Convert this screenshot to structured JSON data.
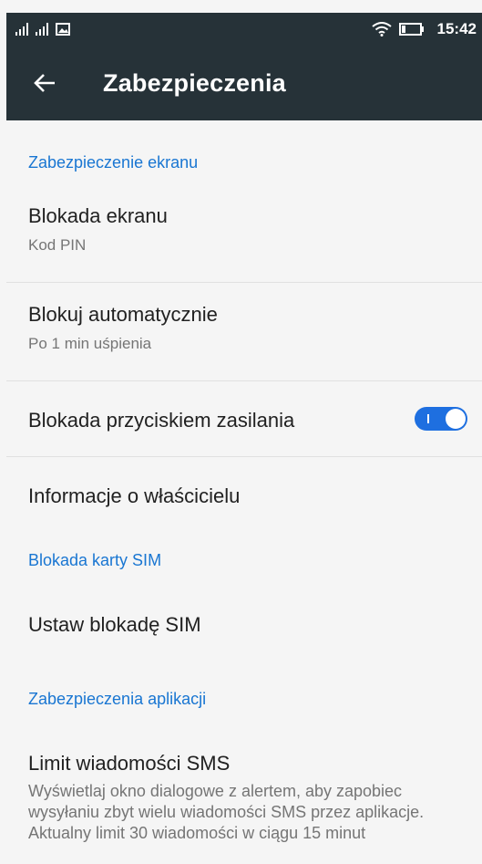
{
  "status_bar": {
    "time": "15:42"
  },
  "header": {
    "title": "Zabezpieczenia"
  },
  "sections": {
    "screen": "Zabezpieczenie ekranu",
    "sim": "Blokada karty SIM",
    "apps": "Zabezpieczenia aplikacji"
  },
  "items": {
    "screen_lock": {
      "title": "Blokada ekranu",
      "subtitle": "Kod PIN"
    },
    "auto_lock": {
      "title": "Blokuj automatycznie",
      "subtitle": "Po 1 min uśpienia"
    },
    "power_lock": {
      "title": "Blokada przyciskiem zasilania",
      "enabled": true
    },
    "owner_info": {
      "title": "Informacje o właścicielu"
    },
    "sim_lock": {
      "title": "Ustaw blokadę SIM"
    },
    "sms_limit": {
      "title": "Limit wiadomości SMS",
      "subtitle": "Wyświetlaj okno dialogowe z alertem, aby zapobiec wysyłaniu zbyt wielu wiadomości SMS przez aplikacje. Aktualny limit 30 wiadomości w ciągu 15 minut"
    }
  },
  "colors": {
    "accent": "#1976d2",
    "toolbar": "#263238",
    "background": "#f5f5f5"
  }
}
